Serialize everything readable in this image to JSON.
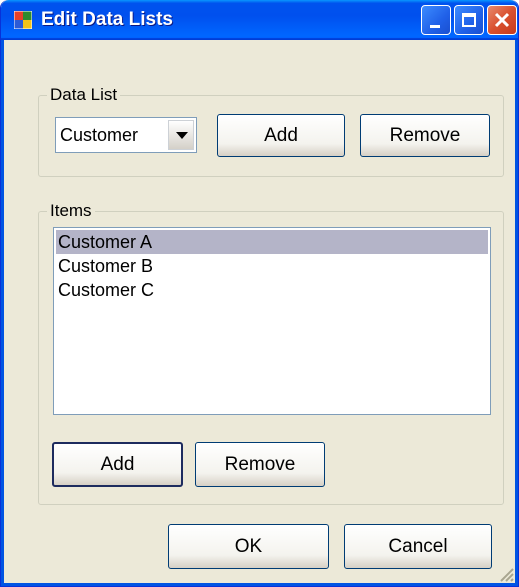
{
  "window": {
    "title": "Edit Data Lists",
    "icons": {
      "app": "window-app-icon",
      "minimize": "minimize-icon",
      "maximize": "maximize-icon",
      "close": "close-icon"
    }
  },
  "data_list_group": {
    "label": "Data List",
    "combo_value": "Customer",
    "add_label": "Add",
    "remove_label": "Remove"
  },
  "items_group": {
    "label": "Items",
    "items": [
      {
        "label": "Customer A",
        "selected": true
      },
      {
        "label": "Customer B",
        "selected": false
      },
      {
        "label": "Customer C",
        "selected": false
      }
    ],
    "add_label": "Add",
    "remove_label": "Remove"
  },
  "footer": {
    "ok_label": "OK",
    "cancel_label": "Cancel"
  },
  "colors": {
    "titlebar": "#0053ee",
    "close_button": "#d9512f",
    "selection": "#b4b4c8",
    "dialog_bg": "#ece9d8"
  }
}
